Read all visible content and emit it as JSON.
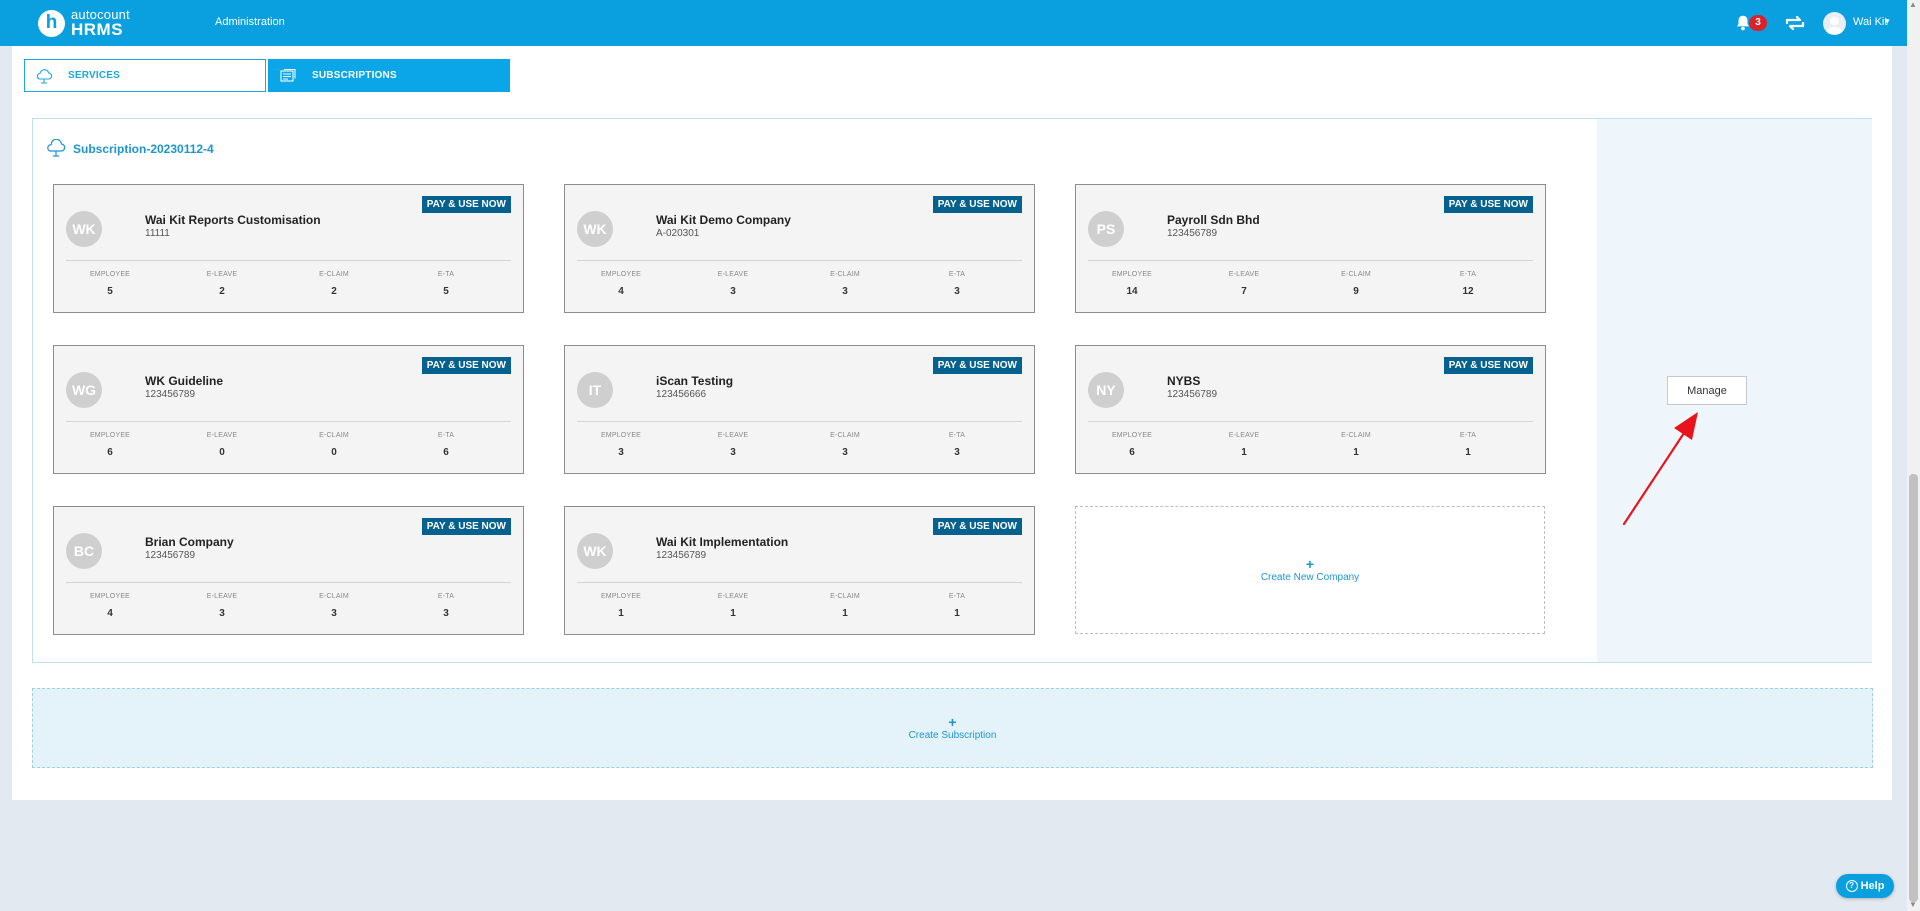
{
  "header": {
    "brand": "autocount",
    "product": "HRMS",
    "nav_admin": "Administration",
    "notifications_count": "3",
    "user_name": "Wai Kit",
    "accent_color": "#0aa0e0"
  },
  "tabs": [
    {
      "label": "SERVICES",
      "icon": "cloud-icon",
      "active": false
    },
    {
      "label": "SUBSCRIPTIONS",
      "icon": "subscriptions-icon",
      "active": true
    }
  ],
  "subscription": {
    "title": "Subscription-20230112-4",
    "manage_label": "Manage",
    "stat_labels": [
      "EMPLOYEE",
      "E-LEAVE",
      "E-CLAIM",
      "E-TA"
    ],
    "pay_label": "PAY & USE NOW",
    "companies": [
      {
        "initials": "WK",
        "name": "Wai Kit Reports Customisation",
        "code": "11111",
        "stats": [
          "5",
          "2",
          "2",
          "5"
        ]
      },
      {
        "initials": "WK",
        "name": "Wai Kit Demo Company",
        "code": "A-020301",
        "stats": [
          "4",
          "3",
          "3",
          "3"
        ]
      },
      {
        "initials": "PS",
        "name": "Payroll Sdn Bhd",
        "code": "123456789",
        "stats": [
          "14",
          "7",
          "9",
          "12"
        ]
      },
      {
        "initials": "WG",
        "name": "WK Guideline",
        "code": "123456789",
        "stats": [
          "6",
          "0",
          "0",
          "6"
        ]
      },
      {
        "initials": "IT",
        "name": "iScan Testing",
        "code": "123456666",
        "stats": [
          "3",
          "3",
          "3",
          "3"
        ]
      },
      {
        "initials": "NY",
        "name": "NYBS",
        "code": "123456789",
        "stats": [
          "6",
          "1",
          "1",
          "1"
        ]
      },
      {
        "initials": "BC",
        "name": "Brian Company",
        "code": "123456789",
        "stats": [
          "4",
          "3",
          "3",
          "3"
        ]
      },
      {
        "initials": "WK",
        "name": "Wai Kit Implementation",
        "code": "123456789",
        "stats": [
          "1",
          "1",
          "1",
          "1"
        ]
      }
    ],
    "create_company_label": "Create New Company",
    "plus": "+"
  },
  "create_subscription_label": "Create Subscription",
  "help_label": "Help"
}
